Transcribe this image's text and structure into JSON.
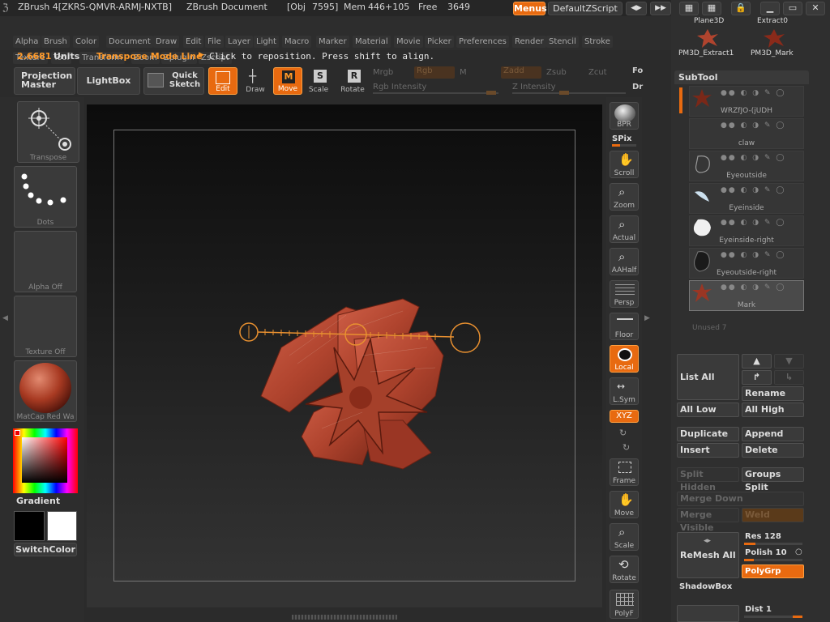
{
  "titlebar": {
    "app": "ZBrush 4[ZKRS-QMVR-ARMJ-NXTB]",
    "document": "ZBrush Document",
    "obj": "[Obj",
    "obj_count": "7595]",
    "mem": "Mem",
    "mem_value": "446+105",
    "free": "Free",
    "free_value": "3649",
    "menus_btn": "Menus",
    "script_btn": "DefaultZScript"
  },
  "menu_items": [
    "Alpha",
    "Brush",
    "Color",
    "Document",
    "Draw",
    "Edit",
    "File",
    "Layer",
    "Light",
    "Macro",
    "Marker",
    "Material",
    "Movie",
    "Picker",
    "Preferences",
    "Render",
    "Stencil",
    "Stroke",
    "Texture",
    "Tool",
    "Transform",
    "Zoom",
    "Zplugin",
    "Zscript"
  ],
  "status": {
    "units_value": "2.6681",
    "units_label": "Units",
    "mode": "Transpose Mode Line",
    "hint": "Click to reposition. Press shift to align."
  },
  "toolbar": {
    "projection_master": "Projection Master",
    "lightbox": "LightBox",
    "quick_sketch": "Quick Sketch",
    "edit": "Edit",
    "draw": "Draw",
    "move": "Move",
    "scale": "Scale",
    "rotate": "Rotate",
    "mrgb": "Mrgb",
    "rgb": "Rgb",
    "m": "M",
    "zadd": "Zadd",
    "zsub": "Zsub",
    "zcut": "Zcut",
    "rgb_intensity": "Rgb Intensity",
    "z_intensity": "Z Intensity",
    "fo": "Fo",
    "dr": "Dr"
  },
  "left_panel": {
    "transpose": "Transpose",
    "dots": "Dots",
    "alpha_off": "Alpha Off",
    "texture_off": "Texture Off",
    "matcap": "MatCap Red Wa",
    "gradient": "Gradient",
    "switch_color": "SwitchColor"
  },
  "right_strip": {
    "bpr": "BPR",
    "spix": "SPix",
    "scroll": "Scroll",
    "zoom": "Zoom",
    "actual": "Actual",
    "aahalf": "AAHalf",
    "persp": "Persp",
    "floor": "Floor",
    "local": "Local",
    "lsym": "L.Sym",
    "xyz": "XYZ",
    "frame": "Frame",
    "move": "Move",
    "scale": "Scale",
    "rotate": "Rotate",
    "polyf": "PolyF"
  },
  "tool_thumbs": {
    "plane3d": "Plane3D",
    "extract0": "Extract0",
    "extract1": "PM3D_Extract1",
    "mark": "PM3D_Mark"
  },
  "subtool": {
    "title": "SubTool",
    "items": [
      "WRZfJO-(jUDH",
      "claw",
      "Eyeoutside",
      "Eyeinside",
      "Eyeinside-right",
      "Eyeoutside-right",
      "Mark"
    ],
    "unused": "Unused 7"
  },
  "subtool_buttons": {
    "list_all": "List All",
    "rename": "Rename",
    "all_low": "All Low",
    "all_high": "All High",
    "duplicate": "Duplicate",
    "append": "Append",
    "insert": "Insert",
    "delete": "Delete",
    "split_hidden": "Split Hidden",
    "groups_split": "Groups Split",
    "merge_down": "Merge Down",
    "merge_visible": "Merge Visible",
    "weld": "Weld",
    "remesh_all": "ReMesh All",
    "res": "Res 128",
    "polish": "Polish 10",
    "polygrp": "PolyGrp",
    "shadowbox": "ShadowBox",
    "dist": "Dist 1"
  },
  "colors": {
    "accent": "#e86a10",
    "model": "#b0442e"
  }
}
